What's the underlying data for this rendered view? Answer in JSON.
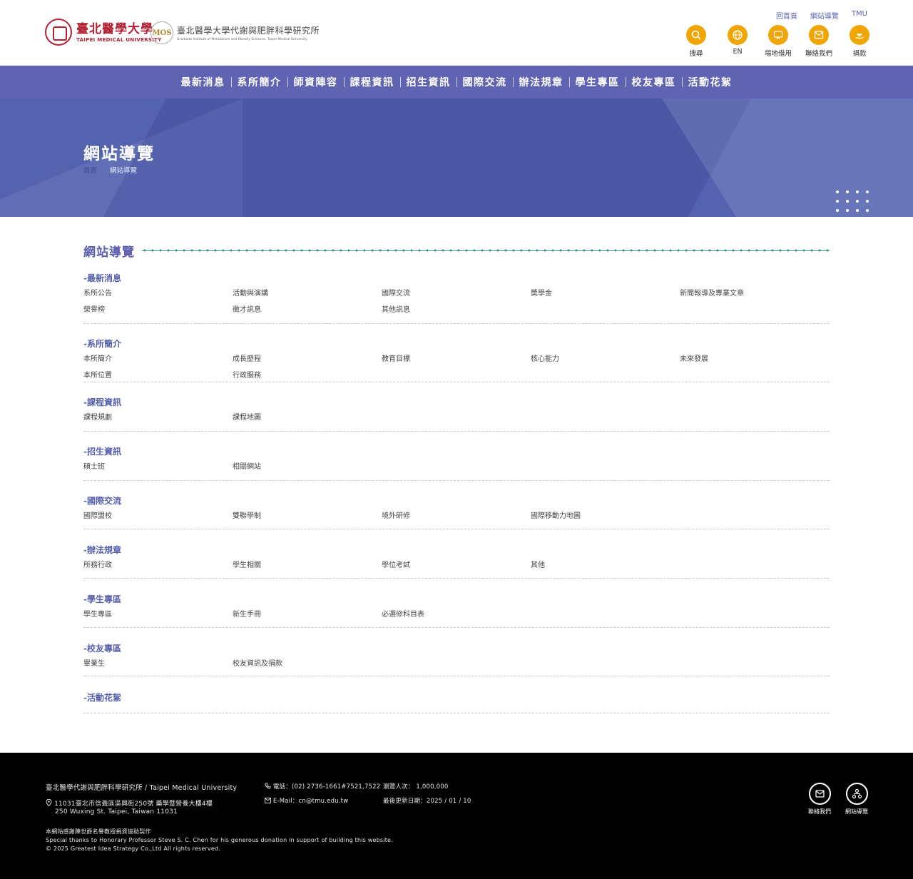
{
  "header": {
    "logo_tmu_cn": "臺北醫學大學",
    "logo_tmu_en": "TAIPEI MEDICAL UNIVERSITY",
    "logo_mos_badge": "MOS",
    "logo_mos_cn": "臺北醫學大學代謝與肥胖科學研究所",
    "logo_mos_en": "Graduate Institute of Metabolism and Obesity Sciences, Taipei Medical University",
    "toplinks": [
      "回首頁",
      "網站導覽",
      "TMU"
    ],
    "quick": [
      {
        "label": "搜尋",
        "icon": "search-icon"
      },
      {
        "label": "EN",
        "icon": "globe-icon"
      },
      {
        "label": "場地借用",
        "icon": "presentation-icon"
      },
      {
        "label": "聯絡我們",
        "icon": "mail-icon"
      },
      {
        "label": "捐款",
        "icon": "donate-icon"
      }
    ],
    "accent": "#f0a500"
  },
  "nav": [
    "最新消息",
    "系所簡介",
    "師資陣容",
    "課程資訊",
    "招生資訊",
    "國際交流",
    "辦法規章",
    "學生專區",
    "校友專區",
    "活動花絮"
  ],
  "banner": {
    "title": "網站導覽",
    "breadcrumb_home": "首頁",
    "breadcrumb_current": "網站導覽"
  },
  "sitemap": {
    "title": "網站導覽",
    "sections": [
      {
        "title": "-最新消息",
        "links": [
          "系所公告",
          "活動與演講",
          "國際交流",
          "獎學金",
          "新聞報導及專業文章",
          "榮譽榜",
          "徵才訊息",
          "其他訊息"
        ]
      },
      {
        "title": "-系所簡介",
        "links": [
          "本所簡介",
          "成長歷程",
          "教育目標",
          "核心能力",
          "未來發展",
          "本所位置",
          "行政服務"
        ]
      },
      {
        "title": "-課程資訊",
        "links": [
          "課程規劃",
          "課程地圖"
        ]
      },
      {
        "title": "-招生資訊",
        "links": [
          "碩士班",
          "相關網站"
        ]
      },
      {
        "title": "-國際交流",
        "links": [
          "國際盟校",
          "雙聯學制",
          "境外研修",
          "國際移動力地圖"
        ]
      },
      {
        "title": "-辦法規章",
        "links": [
          "所務行政",
          "學生相關",
          "學位考試",
          "其他"
        ]
      },
      {
        "title": "-學生專區",
        "links": [
          "學生專區",
          "新生手冊",
          "必選修科目表"
        ]
      },
      {
        "title": "-校友專區",
        "links": [
          "畢業生",
          "校友資訊及捐款"
        ]
      },
      {
        "title": "-活動花絮",
        "links": []
      }
    ]
  },
  "footer": {
    "org": "臺北醫學代謝與肥胖科學研究所 / Taipei Medical University",
    "address_cn": "11031臺北市信義區吳興街250號 藥學暨營養大樓4樓",
    "address_en": "250 Wuxing St. Taipei, Taiwan 11031",
    "phone": "電話：(02) 2736-1661#7521,7522",
    "email": "E-Mail：cn@tmu.edu.tw",
    "visits": "瀏覽人次： 1,000,000",
    "updated": "最後更新日期：2025 / 01 / 10",
    "thanks_cn": "本網站感謝陳世爵名譽教授捐資協助製作",
    "thanks_en": "Special thanks to Honorary Professor Steve S. C. Chen for his generous donation in support of building this website.",
    "copyright": "© 2025 Greatest Idea Strategy Co.,Ltd All rights reserved.",
    "quick": [
      {
        "label": "聯絡我們",
        "icon": "mail-icon"
      },
      {
        "label": "網站導覽",
        "icon": "sitemap-icon"
      }
    ]
  }
}
